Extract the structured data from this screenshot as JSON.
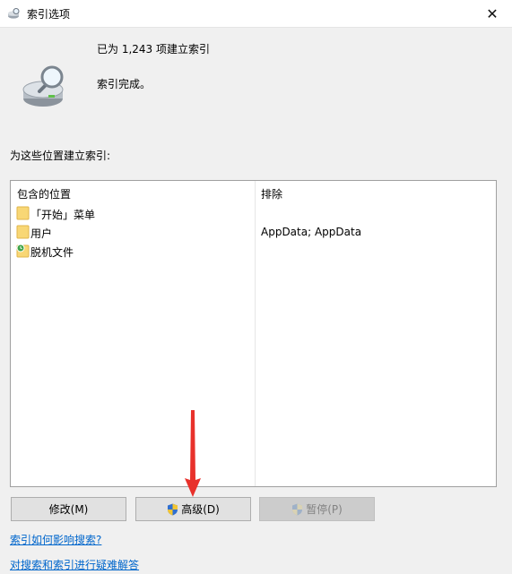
{
  "window": {
    "title": "索引选项",
    "close_glyph": "✕"
  },
  "status": {
    "count_text": "已为 1,243 项建立索引",
    "state_text": "索引完成。"
  },
  "section_label": "为这些位置建立索引:",
  "table": {
    "headers": {
      "included": "包含的位置",
      "excluded": "排除"
    },
    "rows": [
      {
        "label": "「开始」菜单",
        "exclude": "",
        "icon": "folder-icon"
      },
      {
        "label": "用户",
        "exclude": "AppData; AppData",
        "icon": "folder-icon"
      },
      {
        "label": "脱机文件",
        "exclude": "",
        "icon": "offline-files-icon"
      }
    ]
  },
  "buttons": {
    "modify": "修改(M)",
    "advanced": "高级(D)",
    "pause": "暂停(P)"
  },
  "links": {
    "affect_search": "索引如何影响搜索?",
    "troubleshoot": "对搜索和索引进行疑难解答"
  },
  "colors": {
    "link": "#0066cc",
    "folder": "#f8d775",
    "arrow": "#e8312b"
  }
}
